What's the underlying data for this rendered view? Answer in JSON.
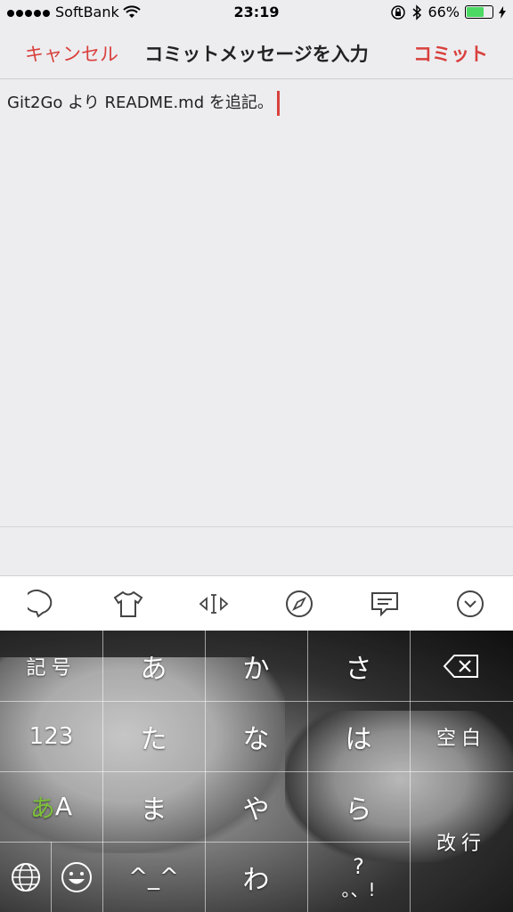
{
  "status_bar": {
    "carrier": "SoftBank",
    "time": "23:19",
    "battery": "66%",
    "battery_level": 0.66
  },
  "nav": {
    "cancel_label": "キャンセル",
    "title": "コミットメッセージを入力",
    "commit_label": "コミット"
  },
  "editor": {
    "text": "Git2Go より README.md を追記。"
  },
  "toolbar": {
    "icons": [
      "chat-bubble-icon",
      "shirt-icon",
      "cursor-move-icon",
      "compass-icon",
      "message-icon",
      "chevron-down-icon"
    ]
  },
  "keyboard": {
    "row1": [
      "記号",
      "あ",
      "か",
      "さ"
    ],
    "row2": [
      "123",
      "た",
      "な",
      "は",
      "空白"
    ],
    "row3_kana": "あ",
    "row3_latin": "A",
    "row3": [
      "ま",
      "や",
      "ら"
    ],
    "enter": "改行",
    "row4": [
      "^_^",
      "わ"
    ],
    "punct_top": "?",
    "punct_bottom": "。、!",
    "accent_color": "#7ec03a"
  },
  "colors": {
    "accent": "#d9403c"
  }
}
